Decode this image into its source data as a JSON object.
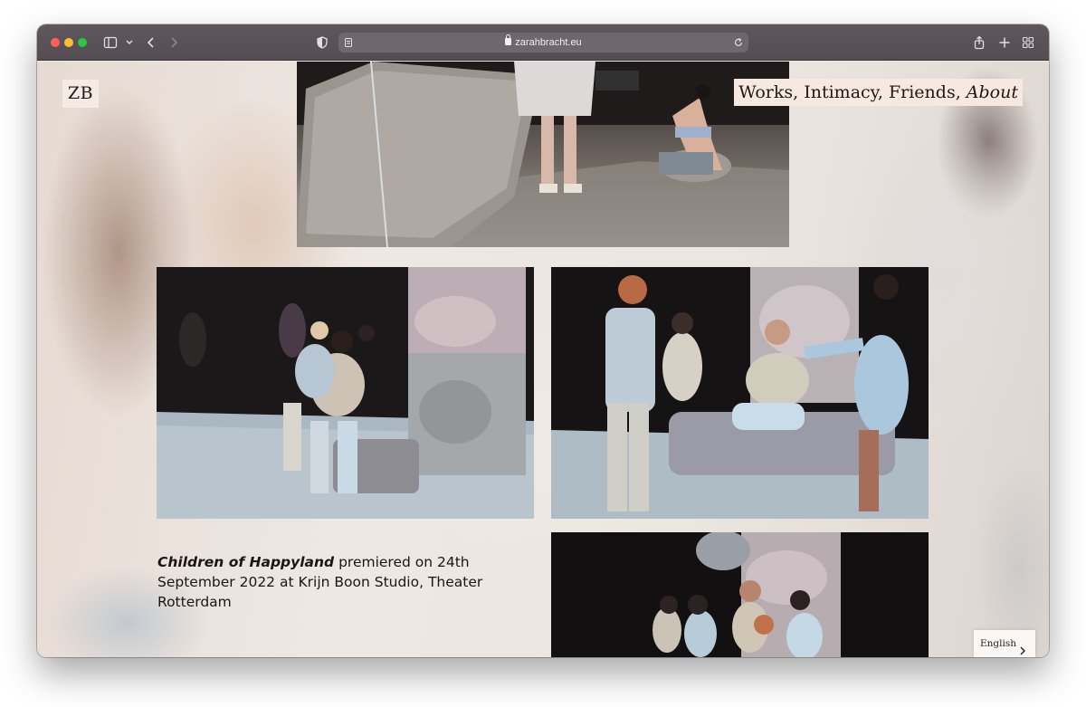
{
  "browser": {
    "url": "zarahbracht.eu",
    "icons": [
      "sidebar-icon",
      "chevron-down-icon",
      "back-arrow-icon",
      "forward-arrow-icon",
      "shield-icon",
      "reader-icon",
      "lock-icon",
      "reload-icon",
      "share-icon",
      "new-tab-icon",
      "tab-overview-icon"
    ]
  },
  "site": {
    "logo": "ZB",
    "nav": {
      "works": "Works,",
      "intimacy": "Intimacy,",
      "friends": "Friends,",
      "about": "About"
    },
    "caption": {
      "title": "Children of Happyland",
      "text": " premiered on 24th September 2022 at Krijn Boon Studio, Theater Rotterdam"
    },
    "language": {
      "label": "English"
    }
  },
  "colors": {
    "toolbar": "#58515a",
    "page_bg": "#ece6e1",
    "nav_bg": "#f8e9e0",
    "text": "#1a1614"
  }
}
